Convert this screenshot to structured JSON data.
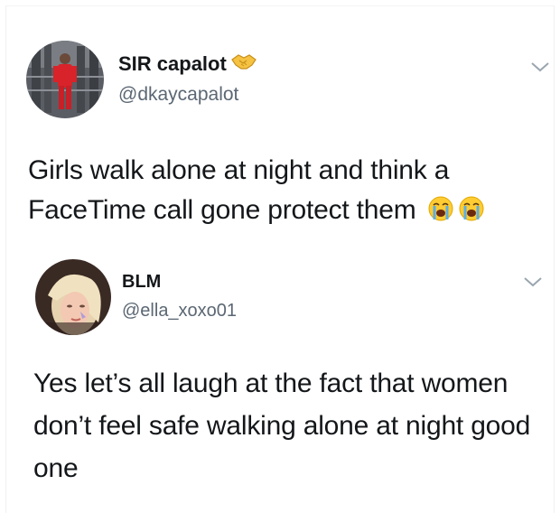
{
  "tweets": [
    {
      "display_name": "SIR capalot",
      "name_emoji": "handshake-icon",
      "handle": "@dkaycapalot",
      "text": "Girls walk alone at night and think a FaceTime call gone protect them",
      "trailing_emojis": [
        "loudly-crying-face-icon",
        "loudly-crying-face-icon"
      ]
    },
    {
      "display_name": "BLM",
      "handle": "@ella_xoxo01",
      "text": "Yes let’s all laugh at the fact that women don’t feel safe walking alone at night good one"
    }
  ],
  "colors": {
    "text": "#14171a",
    "secondary_text": "#5b6773",
    "chevron": "#9aa6b0",
    "emoji_yellow": "#ffcc33",
    "emoji_tear": "#5dade2"
  }
}
